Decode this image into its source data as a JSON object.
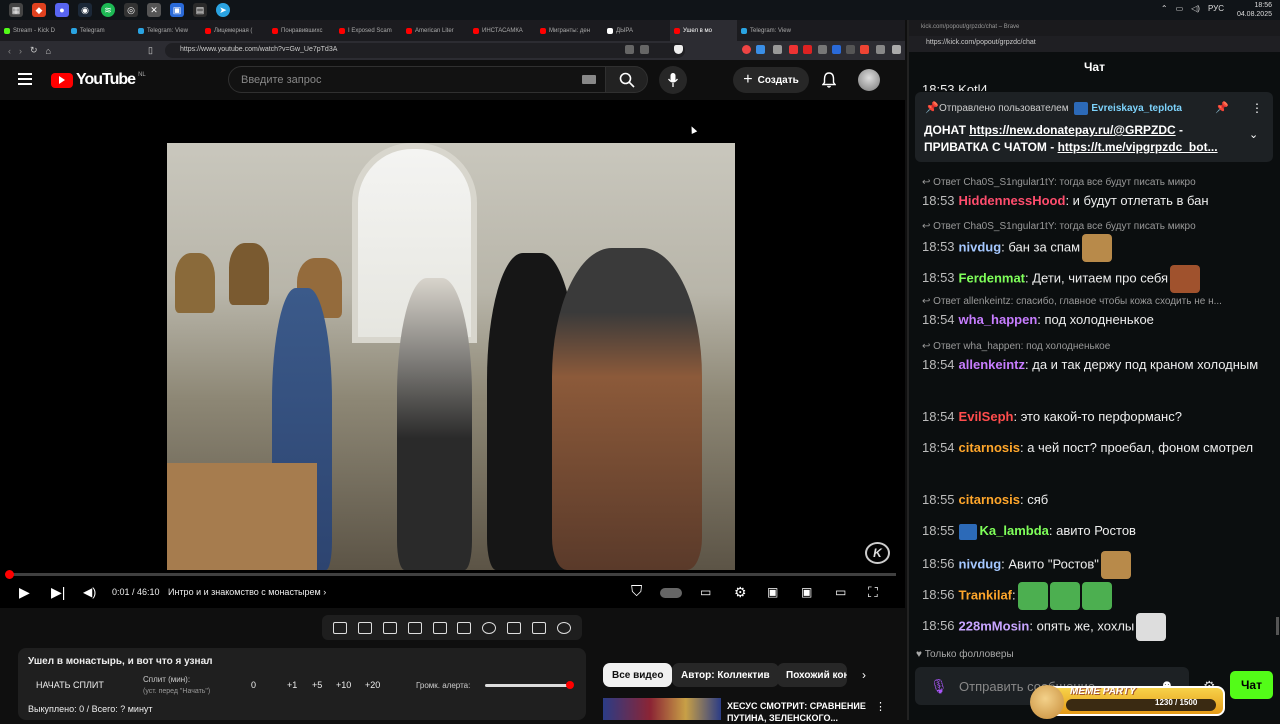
{
  "taskbar": {
    "clock_time": "18:56",
    "clock_date": "04.08.2025",
    "lang": "РУС"
  },
  "browser_left": {
    "tabs": [
      {
        "label": "Stream - Kick D",
        "color": "#53fc18"
      },
      {
        "label": "Telegram",
        "color": "#2aa3e1"
      },
      {
        "label": "Telegram: View",
        "color": "#2aa3e1"
      },
      {
        "label": "Лицемерная (",
        "color": "#ff0000"
      },
      {
        "label": "Понравившихс",
        "color": "#ff0000"
      },
      {
        "label": "I Exposed Scam",
        "color": "#ff0000"
      },
      {
        "label": "American Liter",
        "color": "#ff0000"
      },
      {
        "label": "ИНСТАСАМКА",
        "color": "#ff0000"
      },
      {
        "label": "Мигранты: ден",
        "color": "#ff0000"
      },
      {
        "label": "ДЫРА",
        "color": "#ffffff"
      },
      {
        "label": "Ушел в мо",
        "color": "#ff0000",
        "active": true
      },
      {
        "label": "Telegram: View",
        "color": "#2aa3e1"
      }
    ],
    "url": "https://www.youtube.com/watch?v=Gw_Ue7pTd3A"
  },
  "youtube": {
    "logo": "YouTube",
    "region": "NL",
    "search_placeholder": "Введите запрос",
    "create_label": "Создать",
    "create_icon": "+",
    "time_display": "0:01 / 46:10",
    "chapter": "Интро и и знакомство с монастырем",
    "chapter_arrow": "›",
    "progress_fraction": 0.001,
    "watermark": "K"
  },
  "split_panel": {
    "title": "Ушел в монастырь, и вот что я узнал",
    "start_button": "НАЧАТЬ СПЛИТ",
    "split_min_label": "Сплит (мин):",
    "split_min_sub": "(уст. перед \"Начать\")",
    "value": "0",
    "increments": [
      "+1",
      "+5",
      "+10",
      "+20"
    ],
    "alert_volume_label": "Громк. алерта:",
    "alert_volume_fraction": 0.95,
    "bought": "Выкуплено: 0 / Всего: ? минут"
  },
  "chips": {
    "all_videos": "Все видео",
    "author": "Автор: Коллектив",
    "similar": "Похожий кон",
    "next": "›"
  },
  "recommendation": {
    "title": "ХЕСУС СМОТРИТ: СРАВНЕНИЕ ПУТИНА, ЗЕЛЕНСКОГО..."
  },
  "browser_right": {
    "title": "kick.com/popout/grpzdc/chat – Brave",
    "url": "https://kick.com/popout/grpzdc/chat"
  },
  "chat": {
    "header": "Чат",
    "top_partial": "18:53 Kotl4",
    "pinned": {
      "by_label": "Отправлено пользователем",
      "user": "Evreiskaya_teplota",
      "text_prefix": "ДОНАТ ",
      "link1": "https://new.donatepay.ru/@GRPZDC",
      "text_mid": " - ПРИВАТКА С ЧАТОМ - ",
      "link2": "https://t.me/vipgrpzdc_bot..."
    },
    "messages": [
      {
        "reply": "Ответ Cha0S_S1ngular1tY: тогда все будут писать микро",
        "time": "18:53",
        "user": "HiddennessHood",
        "color": "#ff4d6d",
        "text": ": и будут отлетать в бан"
      },
      {
        "reply": "Ответ Cha0S_S1ngular1tY: тогда все будут писать микро",
        "time": "18:53",
        "user": "nivdug",
        "color": "#a5c8ff",
        "text": ": бан за спам"
      },
      {
        "time": "18:53",
        "user": "Ferdenmat",
        "color": "#7fff5a",
        "text": ": Дети, читаем про себя"
      },
      {
        "reply": "Ответ allenkeintz: спасибо, главное чтобы кожа сходить не н...",
        "time": "18:54",
        "user": "wha_happen",
        "color": "#c77dff",
        "text": ": под холодненькое"
      },
      {
        "reply": "Ответ wha_happen: под холодненькое",
        "time": "18:54",
        "user": "allenkeintz",
        "color": "#c77dff",
        "text": ": да и так держу под краном холодным"
      },
      {
        "time": "18:54",
        "user": "EvilSeph",
        "color": "#ff4d4d",
        "text": ": это какой-то перформанс?"
      },
      {
        "time": "18:54",
        "user": "citarnosis",
        "color": "#ffa62b",
        "text": ": а чей пост? проебал, фоном смотрел"
      },
      {
        "time": "18:55",
        "user": "citarnosis",
        "color": "#ffa62b",
        "text": ": сяб"
      },
      {
        "time": "18:55",
        "user": "Ka_lambda",
        "color": "#7fff5a",
        "text": ": авито Ростов"
      },
      {
        "time": "18:56",
        "user": "nivdug",
        "color": "#a5c8ff",
        "text": ": Авито \"Ростов\""
      },
      {
        "time": "18:56",
        "user": "Trankilaf",
        "color": "#ffa62b",
        "text": ":"
      },
      {
        "time": "18:56",
        "user": "228mMosin",
        "color": "#c8a5ff",
        "text": ": опять же, хохлы"
      }
    ],
    "followers_only": "Только фолловеры",
    "input_placeholder": "Отправить сообщение...",
    "send_label": "Чат"
  },
  "overlay": {
    "title": "MEME PARTY",
    "count": "1230 / 1500"
  }
}
